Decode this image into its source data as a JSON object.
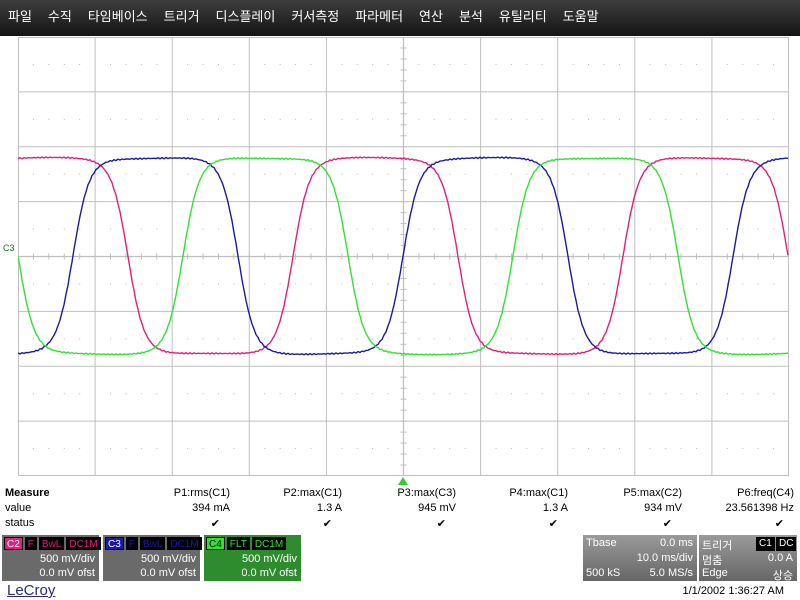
{
  "menu": [
    "파일",
    "수직",
    "타임베이스",
    "트리거",
    "디스플레이",
    "커서측정",
    "파라메터",
    "연산",
    "분석",
    "유틸리티",
    "도움말"
  ],
  "trace_label": "C3",
  "colors": {
    "c1": "#e0207a",
    "c2": "#1a1aa6",
    "c4": "#33e033",
    "grid": "#bfbfbf",
    "trigger": "#33cc33"
  },
  "measure": {
    "title": "Measure",
    "value_label": "value",
    "status_label": "status",
    "params": [
      {
        "name": "P1:rms(C1)",
        "value": "394 mA"
      },
      {
        "name": "P2:max(C1)",
        "value": "1.3 A"
      },
      {
        "name": "P3:max(C3)",
        "value": "945 mV"
      },
      {
        "name": "P4:max(C1)",
        "value": "1.3 A"
      },
      {
        "name": "P5:max(C2)",
        "value": "934 mV"
      },
      {
        "name": "P6:freq(C4)",
        "value": "23.561398 Hz"
      }
    ],
    "check_icon": "✔"
  },
  "channels": [
    {
      "id": "C2",
      "tags": [
        "F",
        "BwL",
        "DC1M"
      ],
      "vdiv": "500 mV/div",
      "ofst": "0.0 mV ofst",
      "color": "#e0207a",
      "bg": "#6a6a6a"
    },
    {
      "id": "C3",
      "tags": [
        "F",
        "BwL",
        "DC1M"
      ],
      "vdiv": "500 mV/div",
      "ofst": "0.0 mV ofst",
      "color": "#1a1aa6",
      "bg": "#6a6a6a"
    },
    {
      "id": "C4",
      "tags": [
        "FLT",
        "DC1M"
      ],
      "vdiv": "500 mV/div",
      "ofst": "0.0 mV ofst",
      "color": "#33e033",
      "bg": "#2e8b2e"
    }
  ],
  "timebase": {
    "label": "Tbase",
    "value": "0.0 ms",
    "div": "10.0 ms/div",
    "samples": "500 kS",
    "rate": "5.0 MS/s"
  },
  "trigger": {
    "label": "트리거",
    "source": "C1",
    "coupling": "DC",
    "mode": "멈춤",
    "level": "0.0 A",
    "type": "Edge",
    "slope": "상승"
  },
  "footer": {
    "logo": "LeCroy",
    "datetime": "1/1/2002 1:36:27 AM"
  }
}
